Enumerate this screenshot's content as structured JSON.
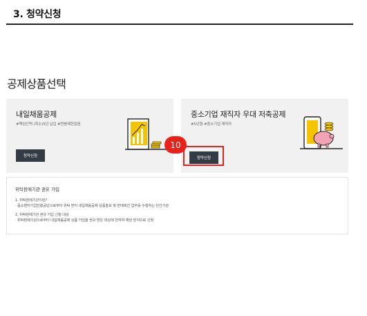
{
  "section": {
    "title": "3. 청약신청"
  },
  "products": {
    "title": "공제상품선택",
    "items": [
      {
        "name": "내일채움공제",
        "tags": "#핵심인력 (최소)5년 납입 #연봉제한없음",
        "button_label": "청약신청"
      },
      {
        "name": "중소기업 재직자 우대 저축공제",
        "tags": "#5년형 #중소기업 재직자",
        "button_label": "청약신청"
      }
    ]
  },
  "annotation": {
    "marker_label": "10",
    "color": "#e8221b"
  },
  "info": {
    "title": "위탁판매기관 권유 가입",
    "lines": [
      "1. 위탁판매기관이란?",
      "· 중소벤처기업진흥공단으로부터 위탁 받아 내일채움공제 상품홍보 및 판매촉진 업무를 수행하는 민간기관",
      "2. 위탁판매기관 권유 가입 신청 대상",
      "· 위탁판매기관으로부터 내일채움공제 상품 가입을 권유 받은 대상에 한하여 해당 방식으로 신청"
    ]
  },
  "colors": {
    "button_bg": "#333b44",
    "card_bg": "#f1f1f1",
    "accent_yellow": "#f5c400",
    "pig_pink": "#f4a3b4"
  }
}
